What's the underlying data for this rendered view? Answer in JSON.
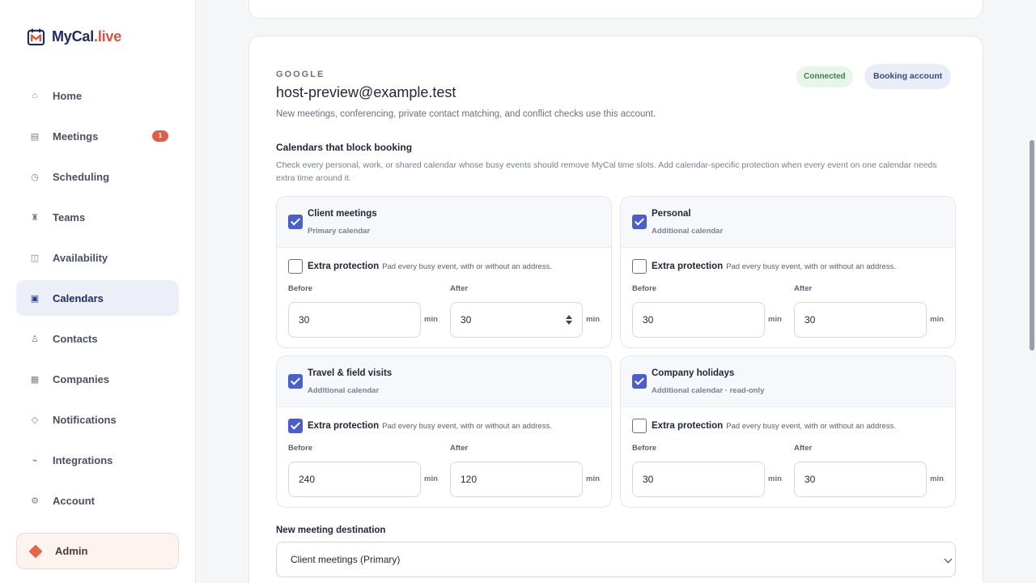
{
  "app": {
    "name_main": "MyCal",
    "name_tld": ".live"
  },
  "sidebar": {
    "items": [
      {
        "label": "Home",
        "icon": "⌂"
      },
      {
        "label": "Meetings",
        "icon": "▤",
        "badge": "1"
      },
      {
        "label": "Scheduling",
        "icon": "◷"
      },
      {
        "label": "Teams",
        "icon": "♜"
      },
      {
        "label": "Availability",
        "icon": "◫"
      },
      {
        "label": "Calendars",
        "icon": "▣"
      },
      {
        "label": "Contacts",
        "icon": "♙"
      },
      {
        "label": "Companies",
        "icon": "▦"
      },
      {
        "label": "Notifications",
        "icon": "◇"
      },
      {
        "label": "Integrations",
        "icon": "⌁"
      },
      {
        "label": "Account",
        "icon": "⚙"
      }
    ],
    "admin_label": "Admin"
  },
  "account": {
    "provider": "GOOGLE",
    "email": "host-preview@example.test",
    "description": "New meetings, conferencing, private contact matching, and conflict checks use this account.",
    "status": "Connected",
    "role": "Booking account"
  },
  "calendars": {
    "title": "Calendars that block booking",
    "description": "Check every personal, work, or shared calendar whose busy events should remove MyCal time slots. Add calendar-specific protection when every event on one calendar needs extra time around it.",
    "protection_label": "Extra protection",
    "protection_desc": "Pad every busy event, with or without an address.",
    "before_label": "Before",
    "after_label": "After",
    "unit": "min",
    "items": [
      {
        "name": "Client meetings",
        "sub": "Primary calendar",
        "checked": true,
        "protection": false,
        "before": "30",
        "after": "30"
      },
      {
        "name": "Personal",
        "sub": "Additional calendar",
        "checked": true,
        "protection": false,
        "before": "30",
        "after": "30"
      },
      {
        "name": "Travel & field visits",
        "sub": "Additional calendar",
        "checked": true,
        "protection": true,
        "before": "240",
        "after": "120"
      },
      {
        "name": "Company holidays",
        "sub": "Additional calendar · read-only",
        "checked": true,
        "protection": false,
        "before": "30",
        "after": "30"
      }
    ]
  },
  "destination": {
    "label": "New meeting destination",
    "value": "Client meetings (Primary)"
  }
}
